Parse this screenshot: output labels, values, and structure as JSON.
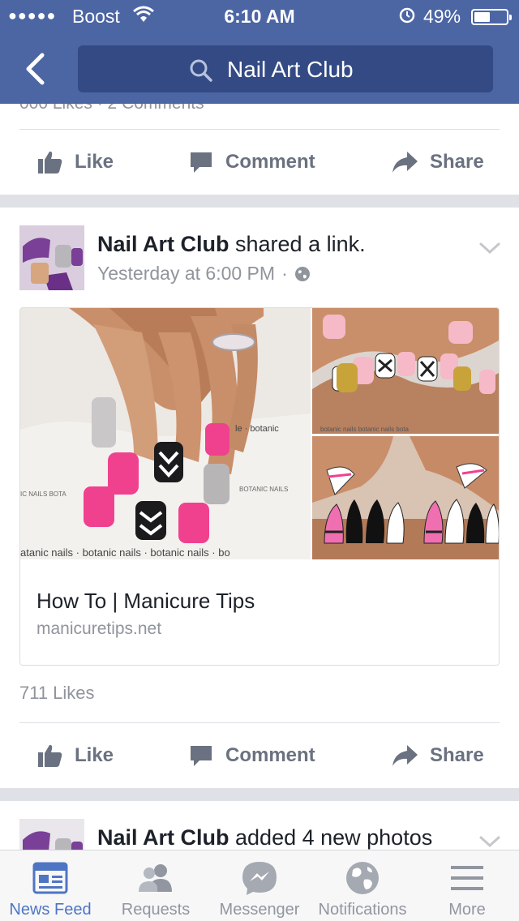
{
  "status_bar": {
    "signal": "●●●●●",
    "carrier": "Boost",
    "time": "6:10 AM",
    "battery": "49%",
    "battery_level": 0.49
  },
  "nav": {
    "search_text": "Nail Art Club"
  },
  "previous_post": {
    "cut_text": "000 Likes · 2 Comments",
    "actions": {
      "like": "Like",
      "comment": "Comment",
      "share": "Share"
    }
  },
  "post": {
    "author": "Nail Art Club",
    "action_text": " shared a link.",
    "timestamp": "Yesterday at 6:00 PM",
    "link": {
      "title": "How To | Manicure Tips",
      "domain": "manicuretips.net"
    },
    "likes": "711 Likes",
    "actions": {
      "like": "Like",
      "comment": "Comment",
      "share": "Share"
    }
  },
  "next_post": {
    "author": "Nail Art Club",
    "action_text": " added 4 new photos"
  },
  "tabbar": {
    "tabs": [
      {
        "label": "News Feed",
        "icon": "news-feed-icon",
        "active": true
      },
      {
        "label": "Requests",
        "icon": "requests-icon",
        "active": false
      },
      {
        "label": "Messenger",
        "icon": "messenger-icon",
        "active": false
      },
      {
        "label": "Notifications",
        "icon": "globe-icon",
        "active": false
      },
      {
        "label": "More",
        "icon": "menu-icon",
        "active": false
      }
    ]
  },
  "colors": {
    "brand_blue": "#4c66a4",
    "search_bg": "#334a84",
    "active_tab": "#4e75c4",
    "nail_pink": "#f0418f"
  }
}
